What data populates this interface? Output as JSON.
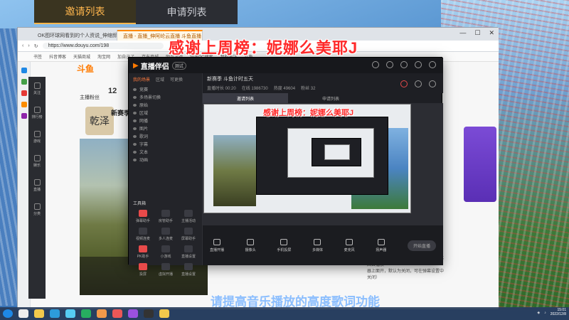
{
  "top_tabs": {
    "invite_list": "邀请列表",
    "apply_list": "申请列表"
  },
  "overlay": {
    "title": "感谢上周榜：妮娜么美耶J",
    "bottom_text": "请提高音乐播放的高度歌词功能",
    "nested_title": "感谢上周榜：妮娜么美耶J"
  },
  "browser": {
    "tabs": [
      "OK图环球网看到的个人资说_伸缩频",
      "直播 - 直播_伸阿纶云直播 斗鱼直播"
    ],
    "url": "https://www.douyu.com/198",
    "bookmarks": [
      "书签",
      "抖音博客",
      "天猫商城",
      "淘宝网",
      "加自己了",
      "京东商城",
      "网页游戏",
      "完美PC搜索",
      "我的关注",
      "斗鱼"
    ],
    "win_controls": [
      "—",
      "☐",
      "✕"
    ]
  },
  "douyu": {
    "logo": "斗鱼",
    "streamer_num": "12",
    "streamer_label": "主播粉丝",
    "avatar_char": "乾泽",
    "room_title": "新赛季新",
    "sidebar": [
      "关注",
      "排行榜",
      "游戏",
      "娱乐",
      "直播",
      "分类"
    ],
    "right_panel": [
      "系统消息：已经开启您的直播（历史弹幕回去播放",
      "器上面开，默认为关闭，可在弹幕设置中关闭）"
    ]
  },
  "app": {
    "name": "直播伴侣",
    "badge": "测试",
    "left_tabs": [
      "我的场景",
      "区域",
      "可更换"
    ],
    "scenes": [
      "竞赛",
      "多场景切换",
      "原始",
      "区域",
      "网播",
      "图片",
      "歌词",
      "字幕",
      "文本",
      "动画"
    ],
    "tools_title": "工具箱",
    "tools": [
      "弹幕助手",
      "房管助手",
      "主播活动",
      "视频连麦",
      "多人连麦",
      "屏幕助手",
      "PK助手",
      "小游戏",
      "直播设置",
      "投屏",
      "虚拟开播",
      "直播设置"
    ],
    "stream_title": "新赛季 斗鱼计时五天",
    "stream_stats": [
      "直播时长 00:20",
      "在线 1986730",
      "热度 49604",
      "粉丝 32"
    ],
    "sub_tabs": [
      "邀请列表",
      "申请列表"
    ],
    "bottom_buttons": [
      "直播开播",
      "摄像头",
      "手机投屏",
      "多媒体",
      "麦克风",
      "扬声器"
    ],
    "start_button": "开始直播"
  },
  "taskbar": {
    "time": "15:01",
    "date": "2022/12/8"
  },
  "colors": {
    "accent": "#ff7a00",
    "overlay_red": "#ff2a2a",
    "app_bg": "#1e1f24"
  }
}
